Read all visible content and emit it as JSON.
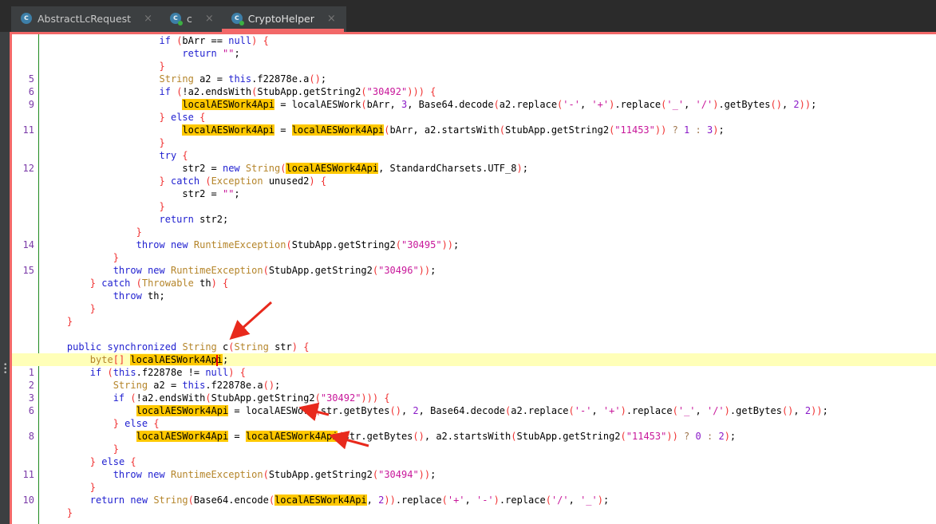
{
  "tabs": [
    {
      "label": "AbstractLcRequest",
      "icon": "abstract-class-icon",
      "glyph": "c",
      "active": false
    },
    {
      "label": "c",
      "icon": "class-icon",
      "glyph": "c",
      "active": false
    },
    {
      "label": "CryptoHelper",
      "icon": "class-icon",
      "glyph": "c",
      "active": true
    }
  ],
  "close_glyph": "×",
  "highlight_identifier": "localAESWork4Api",
  "colors": {
    "accent": "#f26868",
    "highlight": "#ffc800",
    "current_line": "#ffffb8"
  },
  "code": [
    {
      "n": "",
      "t": "                    if (bArr == null) {"
    },
    {
      "n": "",
      "t": "                        return \"\";"
    },
    {
      "n": "",
      "t": "                    }"
    },
    {
      "n": "5",
      "t": "                    String a2 = this.f22878e.a();"
    },
    {
      "n": "6",
      "t": "                    if (!a2.endsWith(StubApp.getString2(\"30492\"))) {"
    },
    {
      "n": "9",
      "t": "                        localAESWork4Api = localAESWork(bArr, 3, Base64.decode(a2.replace('-', '+').replace('_', '/').getBytes(), 2));"
    },
    {
      "n": "",
      "t": "                    } else {"
    },
    {
      "n": "11",
      "t": "                        localAESWork4Api = localAESWork4Api(bArr, a2.startsWith(StubApp.getString2(\"11453\")) ? 1 : 3);"
    },
    {
      "n": "",
      "t": "                    }"
    },
    {
      "n": "",
      "t": "                    try {"
    },
    {
      "n": "12",
      "t": "                        str2 = new String(localAESWork4Api, StandardCharsets.UTF_8);"
    },
    {
      "n": "",
      "t": "                    } catch (Exception unused2) {"
    },
    {
      "n": "",
      "t": "                        str2 = \"\";"
    },
    {
      "n": "",
      "t": "                    }"
    },
    {
      "n": "",
      "t": "                    return str2;"
    },
    {
      "n": "",
      "t": "                }"
    },
    {
      "n": "14",
      "t": "                throw new RuntimeException(StubApp.getString2(\"30495\"));"
    },
    {
      "n": "",
      "t": "            }"
    },
    {
      "n": "15",
      "t": "            throw new RuntimeException(StubApp.getString2(\"30496\"));"
    },
    {
      "n": "",
      "t": "        } catch (Throwable th) {"
    },
    {
      "n": "",
      "t": "            throw th;"
    },
    {
      "n": "",
      "t": "        }"
    },
    {
      "n": "",
      "t": "    }"
    },
    {
      "n": "",
      "t": ""
    },
    {
      "n": "",
      "t": "    public synchronized String c(String str) {"
    },
    {
      "n": "",
      "t": "        byte[] localAESWork4Api;",
      "current": true
    },
    {
      "n": "1",
      "t": "        if (this.f22878e != null) {"
    },
    {
      "n": "2",
      "t": "            String a2 = this.f22878e.a();"
    },
    {
      "n": "3",
      "t": "            if (!a2.endsWith(StubApp.getString2(\"30492\"))) {"
    },
    {
      "n": "6",
      "t": "                localAESWork4Api = localAESWork(str.getBytes(), 2, Base64.decode(a2.replace('-', '+').replace('_', '/').getBytes(), 2));"
    },
    {
      "n": "",
      "t": "            } else {"
    },
    {
      "n": "8",
      "t": "                localAESWork4Api = localAESWork4Api(str.getBytes(), a2.startsWith(StubApp.getString2(\"11453\")) ? 0 : 2);"
    },
    {
      "n": "",
      "t": "            }"
    },
    {
      "n": "",
      "t": "        } else {"
    },
    {
      "n": "11",
      "t": "            throw new RuntimeException(StubApp.getString2(\"30494\"));"
    },
    {
      "n": "",
      "t": "        }"
    },
    {
      "n": "10",
      "t": "        return new String(Base64.encode(localAESWork4Api, 2)).replace('+', '-').replace('/', '_');"
    },
    {
      "n": "",
      "t": "    }"
    }
  ]
}
